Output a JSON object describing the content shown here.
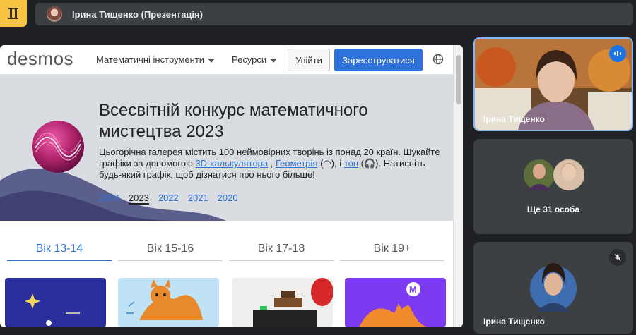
{
  "app": {
    "badge_icon": "app-logo-icon"
  },
  "presentation": {
    "title": "Ірина Тищенко (Презентація)"
  },
  "browser": {
    "logo": "desmos",
    "nav": {
      "math_tools": "Математичні інструменти",
      "resources": "Ресурси",
      "login": "Увійти",
      "signup": "Зареєструватися",
      "globe_icon": "globe-icon"
    },
    "hero": {
      "title": "Всесвітній конкурс математичного мистецтва 2023",
      "desc_part1": "Цьогорічна галерея містить 100 неймовірних творінь із понад 20 країн. Шукайте графіки за допомогою ",
      "link_3d": "3D-калькулятора",
      "desc_part2": " , ",
      "link_geometry": "Геометрія",
      "desc_part3": " (◠), і ",
      "link_tone": "тон",
      "desc_part4": " (🎧). Натисніть будь-який графік, щоб дізнатися про нього більше!",
      "years": [
        "2024",
        "2023",
        "2022",
        "2021",
        "2020"
      ],
      "active_year": "2023"
    },
    "tabs": [
      "Вік 13-14",
      "Вік 15-16",
      "Вік 17-18",
      "Вік 19+"
    ],
    "active_tab": "Вік 13-14",
    "thumbs": [
      "gallery-thumb-1",
      "gallery-thumb-2",
      "gallery-thumb-3",
      "gallery-thumb-4"
    ]
  },
  "participants": {
    "speaker": {
      "name": "Ірина Тищенко"
    },
    "others": {
      "label": "Ще 31 особа"
    },
    "self": {
      "name": "Ірина Тищенко"
    }
  },
  "colors": {
    "accent": "#2f72dc",
    "meet_bg": "#202124",
    "tile_bg": "#3c4043",
    "badge": "#f6c343",
    "speaking": "#8ab4f8"
  }
}
